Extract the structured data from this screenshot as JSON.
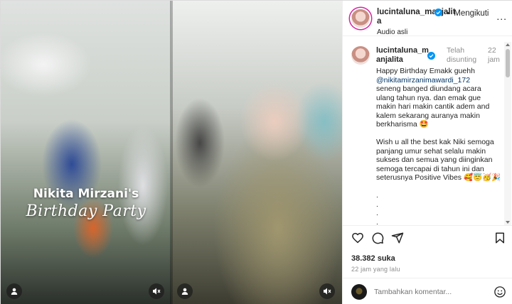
{
  "media": {
    "overlay_line1": "Nikita Mirzani's",
    "overlay_line2": "Birthday Party",
    "buttons": [
      {
        "icon": "user-tag-icon"
      },
      {
        "icon": "mute-icon"
      }
    ]
  },
  "header": {
    "username": "lucintaluna_manjalita",
    "audio": "Audio asli",
    "separator": "•",
    "follow_label": "Mengikuti",
    "more_label": "..."
  },
  "caption": {
    "username": "lucintaluna_manjalita",
    "edited": "Telah disunting",
    "time": "22 jam",
    "text_intro": "Happy Birthday Emakk guehh",
    "mention": "@nikitamirzanimawardi_172",
    "text_body": "seneng banged diundang acara ulang tahun nya. dan emak gue makin hari makin cantik adem and kalem sekarang auranya makin berkharisma 🤩\n\nWish u all the best kak Niki semoga panjang umur sehat selalu makin sukses dan semua yang diinginkan semoga tercapai di tahun ini dan seterusnya Positive Vibes 🥰😇🥳🎉\n\n.\n.\n.\n."
  },
  "actions": {
    "likes": "38.382 suka",
    "time": "22 jam yang lalu"
  },
  "comment_box": {
    "placeholder": "Tambahkan komentar..."
  },
  "colors": {
    "verified": "#0095f6",
    "mention": "#00376b",
    "muted_text": "#8e8e8e"
  }
}
